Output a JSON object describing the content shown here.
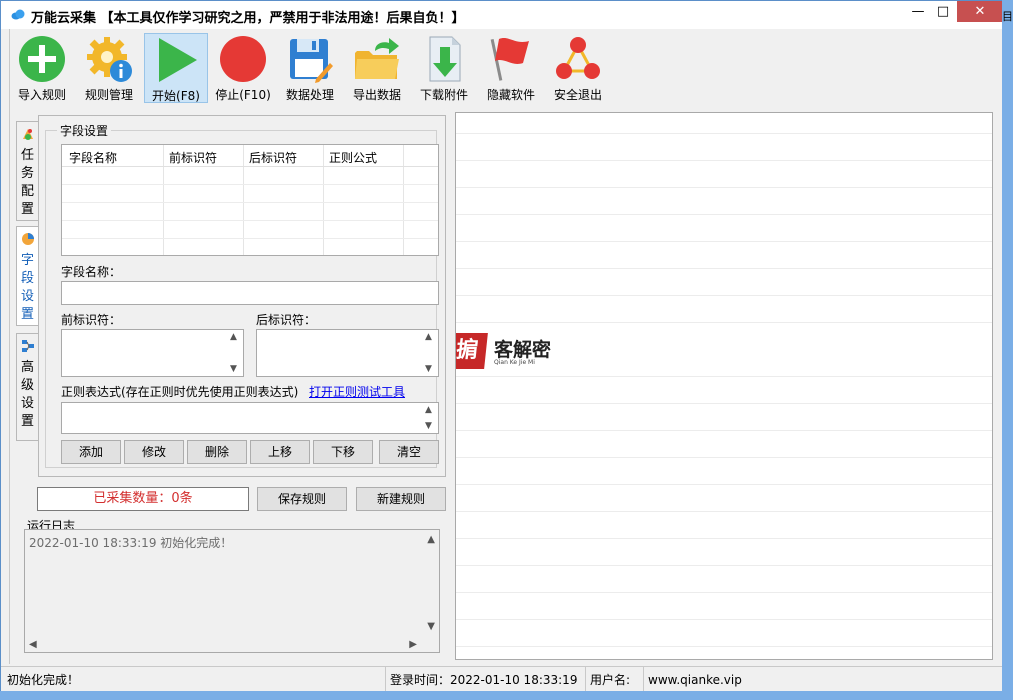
{
  "window": {
    "title": "万能云采集 【本工具仅作学习研究之用，严禁用于非法用途！后果自负！】",
    "minimize_glyph": "—",
    "maximize_glyph": "□",
    "close_glyph": "✕",
    "edge_text": "目"
  },
  "toolbar": {
    "buttons": [
      {
        "label": "导入规则",
        "icon": "add-icon"
      },
      {
        "label": "规则管理",
        "icon": "gear-info-icon"
      },
      {
        "label": "开始(F8)",
        "icon": "play-icon"
      },
      {
        "label": "停止(F10)",
        "icon": "stop-icon"
      },
      {
        "label": "数据处理",
        "icon": "floppy-edit-icon"
      },
      {
        "label": "导出数据",
        "icon": "folder-export-icon"
      },
      {
        "label": "下载附件",
        "icon": "download-file-icon"
      },
      {
        "label": "隐藏软件",
        "icon": "flag-icon"
      },
      {
        "label": "安全退出",
        "icon": "network-icon"
      }
    ],
    "accent": "#cce4f7"
  },
  "tabs": {
    "task": "任务配置",
    "field": "字段设置",
    "advanced": "高级设置"
  },
  "field_settings": {
    "group_title": "字段设置",
    "columns": [
      "字段名称",
      "前标识符",
      "后标识符",
      "正则公式"
    ],
    "field_name_label": "字段名称：",
    "prefix_label": "前标识符：",
    "suffix_label": "后标识符：",
    "regex_label": "正则表达式(存在正则时优先使用正则表达式)",
    "regex_link": "打开正则测试工具",
    "buttons": {
      "add": "添加",
      "modify": "修改",
      "delete": "删除",
      "up": "上移",
      "down": "下移",
      "clear": "清空"
    }
  },
  "collect": {
    "count_text": "已采集数量：0条",
    "save_rule": "保存规则",
    "new_rule": "新建规则"
  },
  "log": {
    "title": "运行日志",
    "lines": [
      "2022-01-10 18:33:19 初始化完成！"
    ]
  },
  "watermark": {
    "badge": "掮",
    "text": "客解密",
    "sub": "Qian Ke Jie Mi"
  },
  "status": {
    "message": "初始化完成！",
    "login_time": "登录时间：2022-01-10 18:33:19",
    "user_label": "用户名:",
    "user_value": "www.qianke.vip"
  },
  "colors": {
    "count_text": "#d32f2f",
    "link": "#0000ee",
    "close_button": "#c75050"
  }
}
